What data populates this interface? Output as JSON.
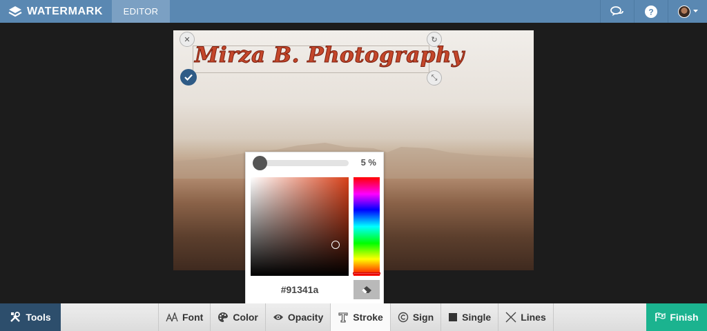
{
  "header": {
    "brand": "WATERMARK",
    "tab_editor": "EDITOR"
  },
  "icons": {
    "logo": "stacked-layers-icon",
    "chat": "chat-bubbles-icon",
    "help": "question-circle-icon",
    "avatar": "user-avatar",
    "caret": "caret-down-icon"
  },
  "watermark": {
    "text": "Mirza B. Photography",
    "color": "#c4462a"
  },
  "picker": {
    "opacity_value": "5 %",
    "opacity_level": 0.05,
    "hex": "#91341a",
    "hue_color": "#d8411a"
  },
  "toolbar": {
    "tools": "Tools",
    "finish": "Finish",
    "options": [
      {
        "label": "Font",
        "icon": "font-size-icon"
      },
      {
        "label": "Color",
        "icon": "palette-icon"
      },
      {
        "label": "Opacity",
        "icon": "eye-icon"
      },
      {
        "label": "Stroke",
        "icon": "text-stroke-icon"
      },
      {
        "label": "Sign",
        "icon": "copyright-icon"
      },
      {
        "label": "Single",
        "icon": "square-icon"
      },
      {
        "label": "Lines",
        "icon": "x-lines-icon"
      }
    ]
  },
  "colors": {
    "topbar": "#5a88b2",
    "tools": "#2d4e6c",
    "finish": "#1bb38f"
  }
}
